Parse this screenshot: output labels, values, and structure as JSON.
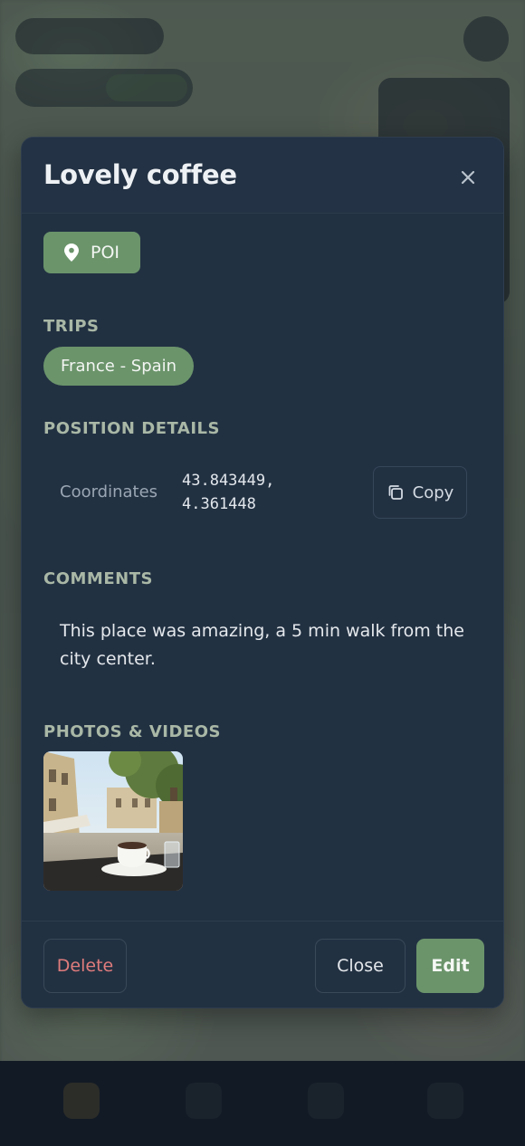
{
  "modal": {
    "title": "Lovely coffee",
    "category": {
      "label": "POI",
      "icon": "map-pin-icon",
      "color": "#6b946b"
    },
    "sections": {
      "trips": "TRIPS",
      "position": "POSITION DETAILS",
      "comments": "COMMENTS",
      "media": "PHOTOS & VIDEOS"
    },
    "trips": [
      "France - Spain"
    ],
    "coordinates": {
      "label": "Coordinates",
      "value": "43.843449,\n4.361448",
      "copy_label": "Copy"
    },
    "comment": "This place was amazing, a 5 min walk from the city center.",
    "photos": [
      {
        "description": "Coffee cup on cafe table in village square"
      }
    ],
    "footer": {
      "delete_label": "Delete",
      "close_label": "Close",
      "edit_label": "Edit"
    }
  },
  "colors": {
    "accent": "#6b946b",
    "danger": "#e07c7c",
    "modal_bg": "#223142"
  }
}
